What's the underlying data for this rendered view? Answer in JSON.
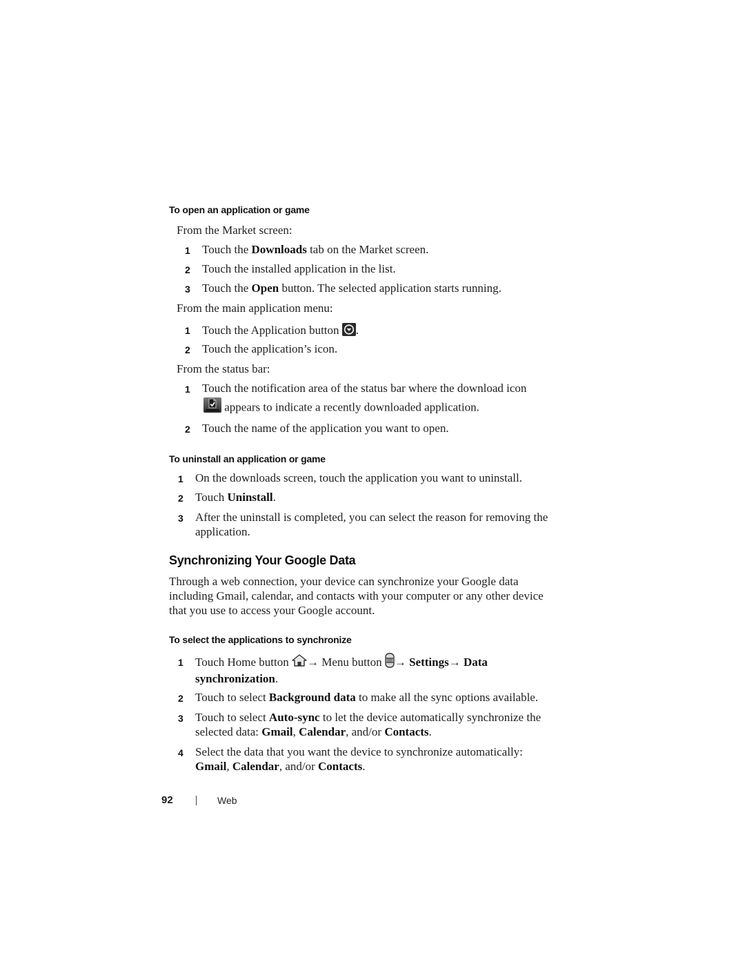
{
  "section_open": {
    "heading": "To open an application or game",
    "from_market": "From the Market screen:",
    "market_steps": [
      {
        "num": "1",
        "pre": "Touch the ",
        "bold": "Downloads",
        "post": " tab on the Market screen."
      },
      {
        "num": "2",
        "text": "Touch the installed application in the list."
      },
      {
        "num": "3",
        "pre": "Touch the ",
        "bold": "Open",
        "post": " button. The selected application starts running."
      }
    ],
    "from_menu": "From the main application menu:",
    "menu_steps": [
      {
        "num": "1",
        "pre": "Touch the Application button ",
        "icon": "application-button-icon",
        "post": "."
      },
      {
        "num": "2",
        "text": "Touch the application’s icon."
      }
    ],
    "from_status": "From the status bar:",
    "status_steps": [
      {
        "num": "1",
        "line1": "Touch the notification area of the status bar where the download icon",
        "icon": "download-complete-icon",
        "line2": " appears to indicate a recently downloaded application."
      },
      {
        "num": "2",
        "text": "Touch the name of the application you want to open."
      }
    ]
  },
  "section_uninstall": {
    "heading": "To uninstall an application or game",
    "steps": [
      {
        "num": "1",
        "text": "On the downloads screen, touch the application you want to uninstall."
      },
      {
        "num": "2",
        "pre": "Touch ",
        "bold": "Uninstall",
        "post": "."
      },
      {
        "num": "3",
        "line1": "After the uninstall is completed, you can select the reason for removing the",
        "line2": "application."
      }
    ]
  },
  "section_sync": {
    "title": "Synchronizing Your Google Data",
    "intro": "Through a web connection, your device can synchronize your Google data including Gmail, calendar, and contacts with your computer or any other device that you use to access your Google account.",
    "procedure_heading": "To select the applications to synchronize",
    "steps": [
      {
        "num": "1",
        "pre": "Touch Home button ",
        "icon1": "home-icon",
        "arrow1": "→ Menu button ",
        "icon2": "menu-icon",
        "arrow2": "→ ",
        "bold1": "Settings",
        "arrow3": "→ ",
        "bold2": "Data",
        "line2_bold": "synchronization",
        "line2_post": "."
      },
      {
        "num": "2",
        "pre": "Touch to select ",
        "bold": "Background data",
        "post": " to make all the sync options available."
      },
      {
        "num": "3",
        "line1_pre": "Touch to select ",
        "line1_bold": "Auto-sync",
        "line1_post": " to let the device automatically synchronize the",
        "line2_pre": "selected data: ",
        "b1": "Gmail",
        "sep1": ", ",
        "b2": "Calendar",
        "sep2": ", and/or ",
        "b3": "Contacts",
        "end": "."
      },
      {
        "num": "4",
        "line1": "Select the data that you want the device to synchronize automatically:",
        "b1": "Gmail",
        "sep1": ", ",
        "b2": "Calendar",
        "sep2": ", and/or ",
        "b3": "Contacts",
        "end": "."
      }
    ]
  },
  "footer": {
    "page_number": "92",
    "chapter": "Web"
  }
}
